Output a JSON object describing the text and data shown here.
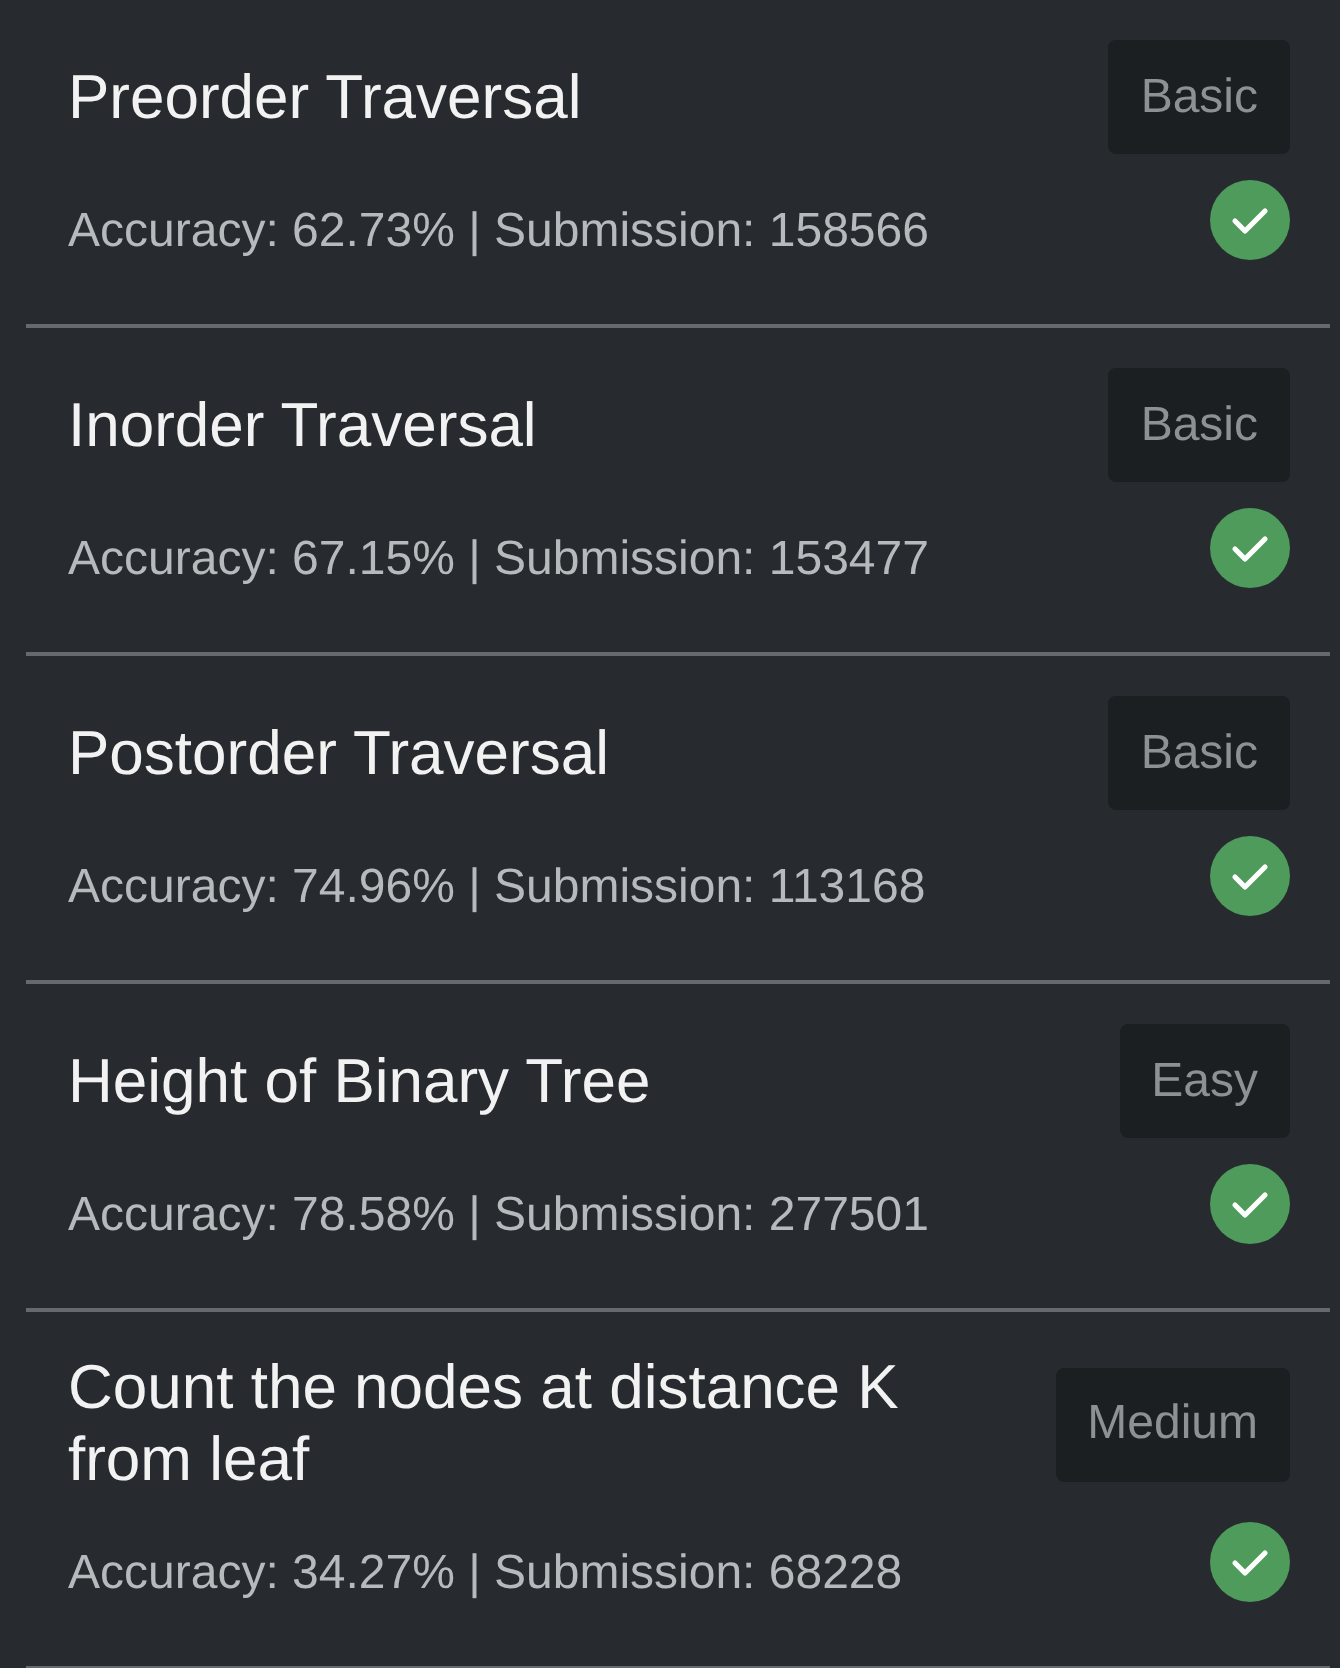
{
  "problems": [
    {
      "title": "Preorder Traversal",
      "difficulty": "Basic",
      "stats": "Accuracy: 62.73% | Submission: 158566",
      "solved": true
    },
    {
      "title": "Inorder Traversal",
      "difficulty": "Basic",
      "stats": "Accuracy: 67.15% | Submission: 153477",
      "solved": true
    },
    {
      "title": "Postorder Traversal",
      "difficulty": "Basic",
      "stats": "Accuracy: 74.96% | Submission: 113168",
      "solved": true
    },
    {
      "title": "Height of Binary Tree",
      "difficulty": "Easy",
      "stats": "Accuracy: 78.58% | Submission: 277501",
      "solved": true
    },
    {
      "title": "Count the nodes at distance K from leaf",
      "difficulty": "Medium",
      "stats": "Accuracy: 34.27% | Submission: 68228",
      "solved": true
    }
  ]
}
